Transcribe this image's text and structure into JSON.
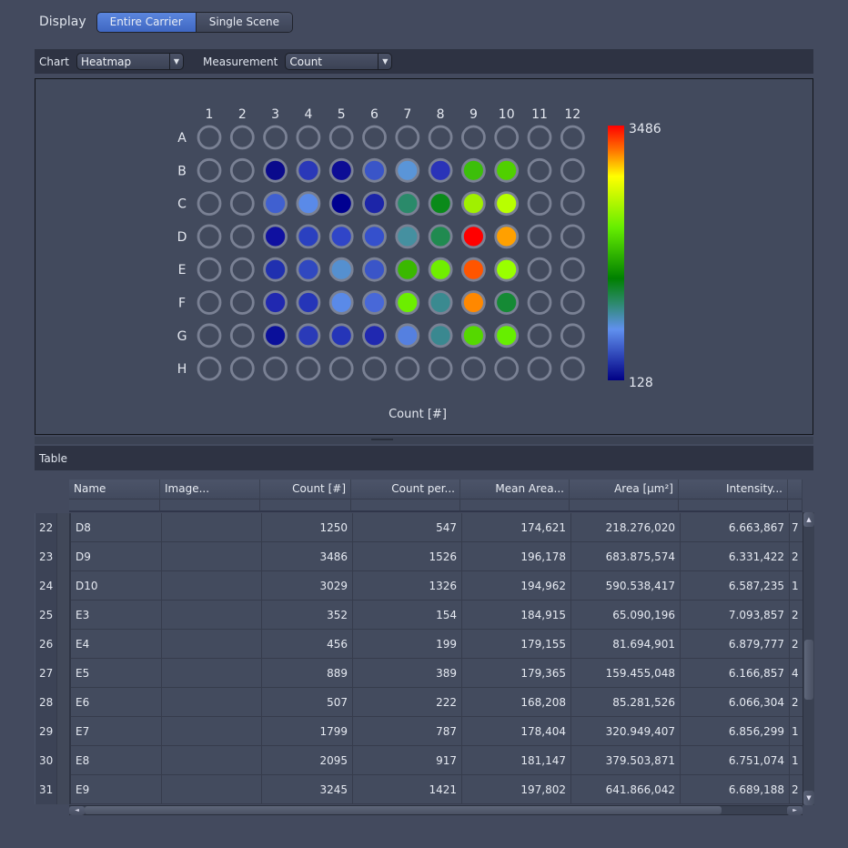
{
  "display": {
    "label": "Display",
    "options": [
      {
        "label": "Entire Carrier",
        "active": true
      },
      {
        "label": "Single Scene",
        "active": false
      }
    ]
  },
  "toolbar": {
    "chart_label": "Chart",
    "chart_value": "Heatmap",
    "measurement_label": "Measurement",
    "measurement_value": "Count"
  },
  "chart_data": {
    "type": "heatmap",
    "title": "",
    "xlabel": "Count [#]",
    "columns": [
      "1",
      "2",
      "3",
      "4",
      "5",
      "6",
      "7",
      "8",
      "9",
      "10",
      "11",
      "12"
    ],
    "rows": [
      "A",
      "B",
      "C",
      "D",
      "E",
      "F",
      "G",
      "H"
    ],
    "colorbar": {
      "min": 128,
      "max": 3486,
      "min_label": "128",
      "max_label": "3486",
      "stops": [
        {
          "pos": 0.0,
          "color": "#ff0000"
        },
        {
          "pos": 0.1,
          "color": "#ff7700"
        },
        {
          "pos": 0.2,
          "color": "#ffff00"
        },
        {
          "pos": 0.4,
          "color": "#66ee00"
        },
        {
          "pos": 0.6,
          "color": "#008000"
        },
        {
          "pos": 0.7,
          "color": "#2e8a70"
        },
        {
          "pos": 0.8,
          "color": "#6090ee"
        },
        {
          "pos": 1.0,
          "color": "#000085"
        }
      ]
    },
    "empty_color": "none",
    "wells": {
      "B": [
        null,
        null,
        "#0a0a8c",
        "#2a38b8",
        "#0d0d95",
        "#3a55c8",
        "#5a95d8",
        "#2a33b8",
        "#3cbf0a",
        "#50d000",
        null,
        null
      ],
      "C": [
        null,
        null,
        "#4060d0",
        "#5a8ae8",
        "#000090",
        "#1c25a8",
        "#2a8a6a",
        "#0a8a1a",
        "#a0f000",
        "#b8ff00",
        null,
        null
      ],
      "D": [
        null,
        null,
        "#0f10a0",
        "#2a40c0",
        "#3045c8",
        "#3550cc",
        "#4590a0",
        "#208a50",
        "#ff0000",
        "#ffa000",
        null,
        null
      ],
      "E": [
        null,
        null,
        "#2030b0",
        "#3048c0",
        "#5590d0",
        "#3a55c8",
        "#3ab800",
        "#70ee00",
        "#ff5500",
        "#99ff00",
        null,
        null
      ],
      "F": [
        null,
        null,
        "#2028b0",
        "#2535b8",
        "#5a8ae8",
        "#4868d8",
        "#6cee00",
        "#3a8a90",
        "#ff8800",
        "#158a35",
        null,
        null
      ],
      "G": [
        null,
        null,
        "#0a0f9a",
        "#2a3ab8",
        "#2535b8",
        "#2028b0",
        "#5580e0",
        "#3a8890",
        "#55d800",
        "#66ee00",
        null,
        null
      ]
    },
    "known_values": {
      "D8": 1250,
      "D9": 3486,
      "D10": 3029,
      "E3": 352,
      "E4": 456,
      "E5": 889,
      "E6": 507,
      "E7": 1799,
      "E8": 2095,
      "E9": 3245
    }
  },
  "table": {
    "title": "Table",
    "columns": [
      "Name",
      "Image...",
      "Count [#]",
      "Count per...",
      "Mean Area...",
      "Area [µm²]",
      "Intensity..."
    ],
    "rows": [
      {
        "num": "22",
        "cells": [
          "D8",
          "",
          "1250",
          "547",
          "174,621",
          "218.276,020",
          "6.663,867",
          "7"
        ]
      },
      {
        "num": "23",
        "cells": [
          "D9",
          "",
          "3486",
          "1526",
          "196,178",
          "683.875,574",
          "6.331,422",
          "2"
        ]
      },
      {
        "num": "24",
        "cells": [
          "D10",
          "",
          "3029",
          "1326",
          "194,962",
          "590.538,417",
          "6.587,235",
          "1"
        ]
      },
      {
        "num": "25",
        "cells": [
          "E3",
          "",
          "352",
          "154",
          "184,915",
          "65.090,196",
          "7.093,857",
          "2"
        ]
      },
      {
        "num": "26",
        "cells": [
          "E4",
          "",
          "456",
          "199",
          "179,155",
          "81.694,901",
          "6.879,777",
          "2"
        ]
      },
      {
        "num": "27",
        "cells": [
          "E5",
          "",
          "889",
          "389",
          "179,365",
          "159.455,048",
          "6.166,857",
          "4"
        ]
      },
      {
        "num": "28",
        "cells": [
          "E6",
          "",
          "507",
          "222",
          "168,208",
          "85.281,526",
          "6.066,304",
          "2"
        ]
      },
      {
        "num": "29",
        "cells": [
          "E7",
          "",
          "1799",
          "787",
          "178,404",
          "320.949,407",
          "6.856,299",
          "1"
        ]
      },
      {
        "num": "30",
        "cells": [
          "E8",
          "",
          "2095",
          "917",
          "181,147",
          "379.503,871",
          "6.751,074",
          "1"
        ]
      },
      {
        "num": "31",
        "cells": [
          "E9",
          "",
          "3245",
          "1421",
          "197,802",
          "641.866,042",
          "6.689,188",
          "2"
        ]
      }
    ]
  },
  "icons": {
    "dropdown": "▼",
    "scroll_up": "▲",
    "scroll_down": "▼",
    "scroll_left": "◄",
    "scroll_right": "►"
  }
}
